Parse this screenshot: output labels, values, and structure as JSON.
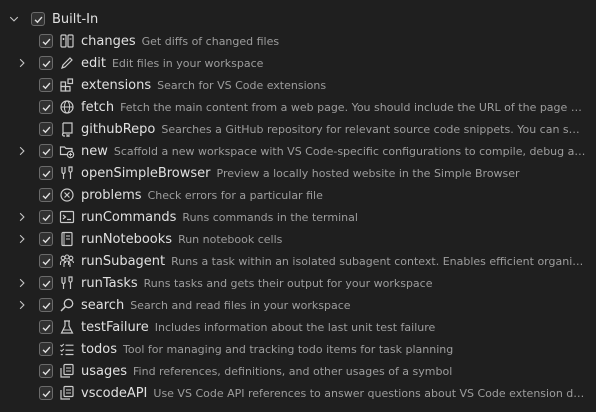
{
  "group": {
    "label": "Built-In",
    "expanded": true,
    "checked": true
  },
  "tools": [
    {
      "name": "changes",
      "desc": "Get diffs of changed files",
      "icon": "diff-icon",
      "expandable": false,
      "checked": true
    },
    {
      "name": "edit",
      "desc": "Edit files in your workspace",
      "icon": "pencil-icon",
      "expandable": true,
      "checked": true
    },
    {
      "name": "extensions",
      "desc": "Search for VS Code extensions",
      "icon": "extensions-icon",
      "expandable": false,
      "checked": true
    },
    {
      "name": "fetch",
      "desc": "Fetch the main content from a web page. You should include the URL of the page you ...",
      "icon": "globe-icon",
      "expandable": false,
      "checked": true
    },
    {
      "name": "githubRepo",
      "desc": "Searches a GitHub repository for relevant source code snippets. You can specify...",
      "icon": "repo-icon",
      "expandable": false,
      "checked": true
    },
    {
      "name": "new",
      "desc": "Scaffold a new workspace with VS Code-specific configurations to compile, debug and r...",
      "icon": "new-folder-icon",
      "expandable": true,
      "checked": true
    },
    {
      "name": "openSimpleBrowser",
      "desc": "Preview a locally hosted website in the Simple Browser",
      "icon": "tools-icon",
      "expandable": false,
      "checked": true
    },
    {
      "name": "problems",
      "desc": "Check errors for a particular file",
      "icon": "error-circle-icon",
      "expandable": false,
      "checked": true
    },
    {
      "name": "runCommands",
      "desc": "Runs commands in the terminal",
      "icon": "terminal-icon",
      "expandable": true,
      "checked": true
    },
    {
      "name": "runNotebooks",
      "desc": "Run notebook cells",
      "icon": "notebook-icon",
      "expandable": true,
      "checked": true
    },
    {
      "name": "runSubagent",
      "desc": "Runs a task within an isolated subagent context. Enables efficient organizatio...",
      "icon": "organization-icon",
      "expandable": false,
      "checked": true
    },
    {
      "name": "runTasks",
      "desc": "Runs tasks and gets their output for your workspace",
      "icon": "tools-icon",
      "expandable": true,
      "checked": true
    },
    {
      "name": "search",
      "desc": "Search and read files in your workspace",
      "icon": "search-icon",
      "expandable": true,
      "checked": true
    },
    {
      "name": "testFailure",
      "desc": "Includes information about the last unit test failure",
      "icon": "beaker-icon",
      "expandable": false,
      "checked": true
    },
    {
      "name": "todos",
      "desc": "Tool for managing and tracking todo items for task planning",
      "icon": "checklist-icon",
      "expandable": false,
      "checked": true
    },
    {
      "name": "usages",
      "desc": "Find references, definitions, and other usages of a symbol",
      "icon": "references-icon",
      "expandable": false,
      "checked": true
    },
    {
      "name": "vscodeAPI",
      "desc": "Use VS Code API references to answer questions about VS Code extension develo...",
      "icon": "references-icon",
      "expandable": false,
      "checked": true
    }
  ]
}
